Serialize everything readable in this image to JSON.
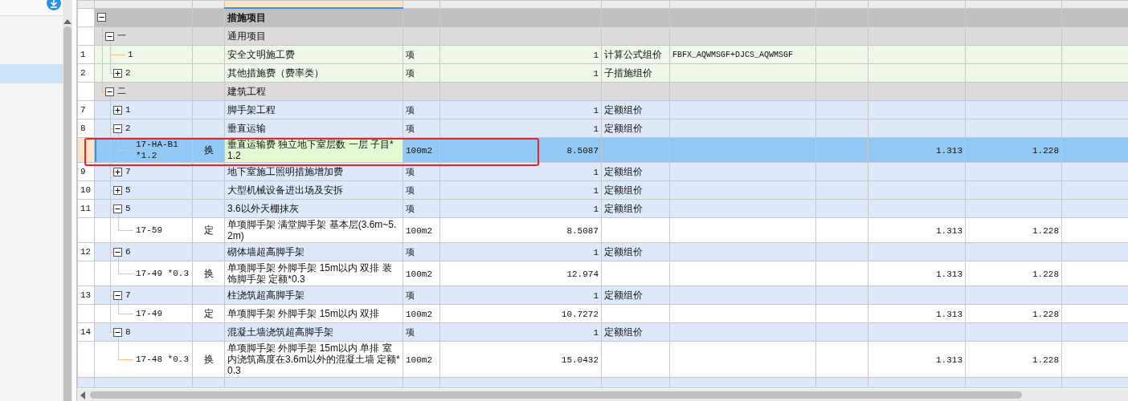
{
  "sidebar": {
    "items": [
      {
        "selected": false
      },
      {
        "selected": false
      },
      {
        "selected": true
      }
    ]
  },
  "columns": [
    {
      "selected": false
    },
    {
      "selected": false
    },
    {
      "selected": false
    },
    {
      "selected": true
    },
    {
      "selected": false
    },
    {
      "selected": false
    },
    {
      "selected": false
    },
    {
      "selected": false
    },
    {
      "selected": false
    },
    {
      "selected": false
    },
    {
      "selected": false
    },
    {
      "selected": false
    }
  ],
  "rows": [
    {
      "kind": "root",
      "expanded": true,
      "selected": false,
      "name": "措施项目",
      "children": [
        {
          "kind": "section",
          "expanded": true,
          "selected": false,
          "code": "一",
          "name": "通用项目",
          "children": [
            {
              "kind": "general",
              "selected": false,
              "rownum": "1",
              "code": "1",
              "name": "安全文明施工费",
              "unit": "项",
              "qty": "1",
              "method": "计算公式组价",
              "base": "FBFX_AQWMSGF+DJCS_AQWMSGF"
            },
            {
              "kind": "general",
              "expanded": false,
              "selected": false,
              "rownum": "2",
              "code": "2",
              "name": "其他措施费（费率类）",
              "unit": "项",
              "qty": "1",
              "method": "子措施组价"
            }
          ]
        },
        {
          "kind": "section",
          "expanded": true,
          "selected": false,
          "code": "二",
          "name": "建筑工程",
          "children": [
            {
              "kind": "measure",
              "expanded": false,
              "selected": false,
              "rownum": "7",
              "code": "1",
              "name": "脚手架工程",
              "unit": "项",
              "qty": "1",
              "method": "定额组价"
            },
            {
              "kind": "measure",
              "expanded": true,
              "selected": false,
              "rownum": "8",
              "code": "2",
              "name": "垂直运输",
              "unit": "项",
              "qty": "1",
              "method": "定额组价",
              "children": [
                {
                  "kind": "quota",
                  "selected": true,
                  "code": "17-HA-B1 *1.2",
                  "type": "换",
                  "name": "垂直运输费 独立地下室层数 一层  子目*1.2",
                  "unit": "100m2",
                  "qty": "8.5087",
                  "labor": "1.313",
                  "machine": "1.228"
                }
              ]
            },
            {
              "kind": "measure",
              "expanded": false,
              "selected": false,
              "rownum": "9",
              "code": "7",
              "name": "地下室施工照明措施增加费",
              "unit": "项",
              "qty": "1",
              "method": "定额组价"
            },
            {
              "kind": "measure",
              "expanded": false,
              "selected": false,
              "rownum": "10",
              "code": "5",
              "name": "大型机械设备进出场及安拆",
              "unit": "项",
              "qty": "1",
              "method": "定额组价"
            },
            {
              "kind": "measure",
              "expanded": true,
              "selected": false,
              "rownum": "11",
              "code": "5",
              "name": "3.6以外天棚抹灰",
              "unit": "项",
              "qty": "1",
              "method": "定额组价",
              "children": [
                {
                  "kind": "quota",
                  "selected": false,
                  "code": "17-59",
                  "type": "定",
                  "name": "单项脚手架 满堂脚手架 基本层(3.6m~5.2m)",
                  "unit": "100m2",
                  "qty": "8.5087",
                  "labor": "1.313",
                  "machine": "1.228"
                }
              ]
            },
            {
              "kind": "measure",
              "expanded": true,
              "selected": false,
              "rownum": "12",
              "code": "6",
              "name": "砌体墙超高脚手架",
              "unit": "项",
              "qty": "1",
              "method": "定额组价",
              "children": [
                {
                  "kind": "quota",
                  "selected": false,
                  "code": "17-49 *0.3",
                  "type": "换",
                  "name": "单项脚手架 外脚手架 15m以内 双排  装饰脚手架 定额*0.3",
                  "unit": "100m2",
                  "qty": "12.974",
                  "labor": "1.313",
                  "machine": "1.228"
                }
              ]
            },
            {
              "kind": "measure",
              "expanded": true,
              "selected": false,
              "rownum": "13",
              "code": "7",
              "name": "柱浇筑超高脚手架",
              "unit": "项",
              "qty": "1",
              "method": "定额组价",
              "children": [
                {
                  "kind": "quota",
                  "selected": false,
                  "code": "17-49",
                  "type": "定",
                  "name": "单项脚手架 外脚手架 15m以内 双排",
                  "unit": "100m2",
                  "qty": "10.7272",
                  "labor": "1.313",
                  "machine": "1.228"
                }
              ]
            },
            {
              "kind": "measure",
              "expanded": true,
              "selected": false,
              "rownum": "14",
              "code": "8",
              "name": "混凝土墙浇筑超高脚手架",
              "unit": "项",
              "qty": "1",
              "method": "定额组价",
              "children": [
                {
                  "kind": "quota",
                  "selected": false,
                  "code": "17-48 *0.3",
                  "type": "换",
                  "name": "单项脚手架 外脚手架 15m以内 单排  室内浇筑高度在3.6m以外的混凝土墙 定额*0.3",
                  "unit": "100m2",
                  "qty": "15.0432",
                  "labor": "1.313",
                  "machine": "1.228"
                }
              ]
            }
          ]
        }
      ]
    }
  ]
}
